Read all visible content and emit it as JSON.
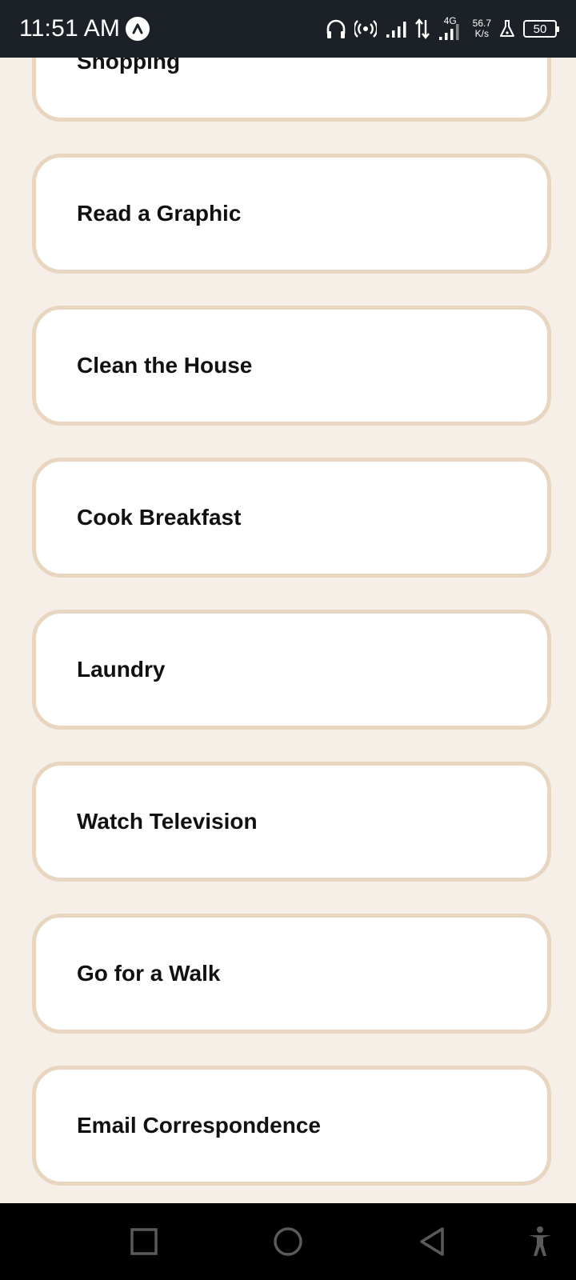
{
  "status_bar": {
    "time": "11:51 AM",
    "network_type": "4G",
    "net_speed_value": "56.7",
    "net_speed_unit": "K/s",
    "battery_level": "50"
  },
  "activities": [
    {
      "label": "Shopping"
    },
    {
      "label": "Read a Graphic"
    },
    {
      "label": "Clean the House"
    },
    {
      "label": "Cook Breakfast"
    },
    {
      "label": "Laundry"
    },
    {
      "label": "Watch Television"
    },
    {
      "label": "Go for a Walk"
    },
    {
      "label": "Email Correspondence"
    }
  ],
  "icons": {
    "app_badge": "app-notification-icon",
    "headphones": "headphones-icon",
    "hotspot": "hotspot-icon",
    "signal": "signal-icon",
    "data": "data-transfer-icon",
    "lab": "flask-icon",
    "nav_recents": "recents-square-icon",
    "nav_home": "home-circle-icon",
    "nav_back": "back-triangle-icon",
    "accessibility": "accessibility-icon"
  },
  "colors": {
    "background": "#f6efe8",
    "card_border": "#e8d6c1",
    "card_fill": "#ffffff",
    "status_bar": "#1c2127",
    "nav_bar": "#000000"
  }
}
